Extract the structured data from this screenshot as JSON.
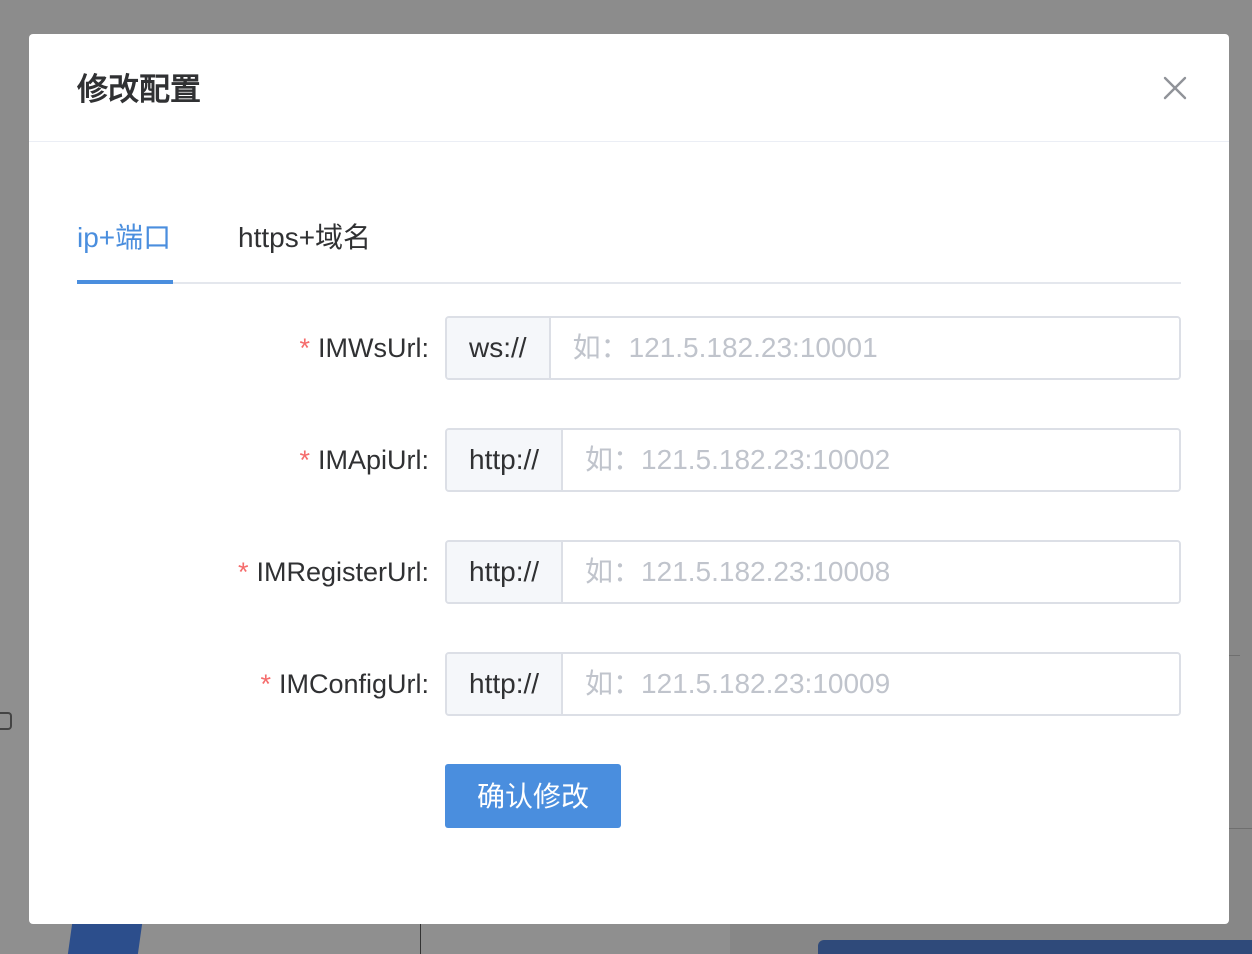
{
  "modal": {
    "title": "修改配置"
  },
  "tabs": [
    {
      "label": "ip+端口",
      "active": true
    },
    {
      "label": "https+域名",
      "active": false
    }
  ],
  "form": {
    "fields": [
      {
        "label": "IMWsUrl:",
        "required_mark": "*",
        "prefix": "ws://",
        "placeholder": "如：121.5.182.23:10001",
        "value": ""
      },
      {
        "label": "IMApiUrl:",
        "required_mark": "*",
        "prefix": "http://",
        "placeholder": "如：121.5.182.23:10002",
        "value": ""
      },
      {
        "label": "IMRegisterUrl:",
        "required_mark": "*",
        "prefix": "http://",
        "placeholder": "如：121.5.182.23:10008",
        "value": ""
      },
      {
        "label": "IMConfigUrl:",
        "required_mark": "*",
        "prefix": "http://",
        "placeholder": "如：121.5.182.23:10009",
        "value": ""
      }
    ],
    "submit_label": "确认修改"
  },
  "colors": {
    "accent": "#4a8ede",
    "required": "#f56c6c",
    "overlay": "#8a8a8a"
  },
  "icons": {
    "close": "close-icon"
  }
}
